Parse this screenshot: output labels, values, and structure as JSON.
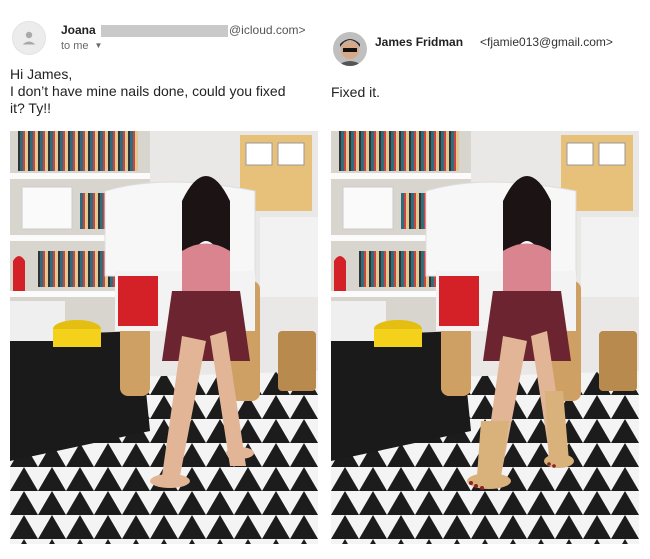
{
  "left_email": {
    "sender_name": "Joana",
    "sender_email_suffix": "@icloud.com>",
    "recipient_label": "to me",
    "caret_icon": "chevron-down-icon",
    "avatar_icon": "person-icon",
    "body_lines": [
      "Hi James,",
      "I don’t have mine nails done, could you fixed",
      "it? Ty!!"
    ],
    "photo": {
      "subject": "woman sitting barefoot in a wooden armchair on a black-and-white triangle rug",
      "nail_polish": "none"
    }
  },
  "right_email": {
    "sender_name": "James Fridman",
    "sender_email": "<fjamie013@gmail.com>",
    "body_text": "Fixed it.",
    "avatar_icon": "user-photo-avatar",
    "photo": {
      "subject": "same photo with beige nylon socks with dark toes drawn on the feet",
      "nail_polish": "painted toes on stockings"
    }
  },
  "colors": {
    "sender_name": "#222222",
    "secondary_text": "#555555",
    "redaction": "#c9c9c9",
    "dress_top": "#d9848e",
    "skirt": "#6b2430",
    "cushion": "#d42128",
    "bowl": "#f4d21c",
    "stocking": "#d8b27a"
  }
}
